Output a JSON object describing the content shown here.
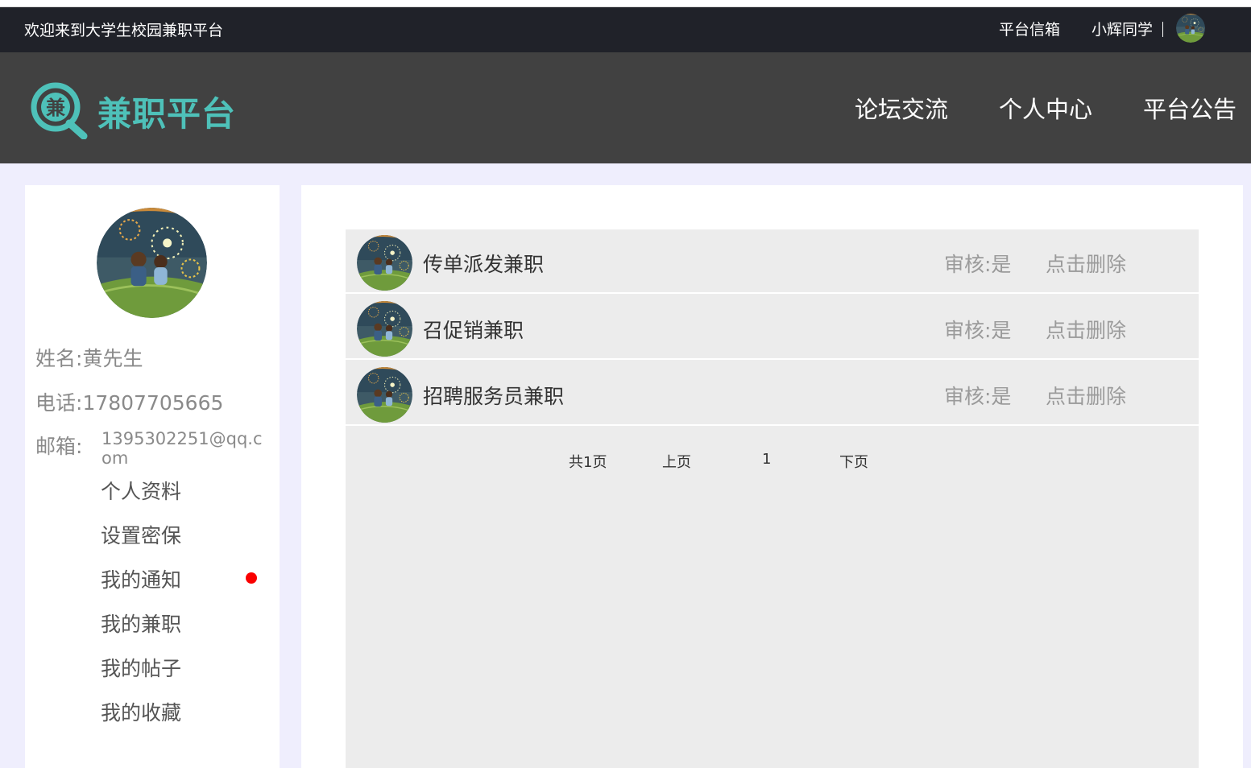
{
  "topbar": {
    "welcome": "欢迎来到大学生校园兼职平台",
    "mailbox": "平台信箱",
    "username": "小辉同学"
  },
  "header": {
    "logo_char": "兼",
    "logo_text": "兼职平台",
    "nav": [
      {
        "label": "论坛交流"
      },
      {
        "label": "个人中心"
      },
      {
        "label": "平台公告"
      }
    ]
  },
  "profile": {
    "name_label": "姓名:",
    "name_value": "黄先生",
    "phone_label": "电话:",
    "phone_value": "17807705665",
    "email_label": "邮箱:",
    "email_value": "1395302251@qq.com"
  },
  "menu": [
    {
      "label": "个人资料"
    },
    {
      "label": "设置密保"
    },
    {
      "label": "我的通知",
      "has_notification": true
    },
    {
      "label": "我的兼职"
    },
    {
      "label": "我的帖子"
    },
    {
      "label": "我的收藏"
    }
  ],
  "jobs": [
    {
      "title": "传单派发兼职",
      "audit": "审核:是",
      "delete": "点击删除"
    },
    {
      "title": "召促销兼职",
      "audit": "审核:是",
      "delete": "点击删除"
    },
    {
      "title": "招聘服务员兼职",
      "audit": "审核:是",
      "delete": "点击删除"
    }
  ],
  "pagination": {
    "total": "共1页",
    "prev": "上页",
    "current": "1",
    "next": "下页"
  },
  "colors": {
    "topbar_bg": "#202229",
    "header_bg": "#414141",
    "brand": "#4ec1b9",
    "page_bg": "#efeefd",
    "notification_dot": "#fa0000"
  }
}
